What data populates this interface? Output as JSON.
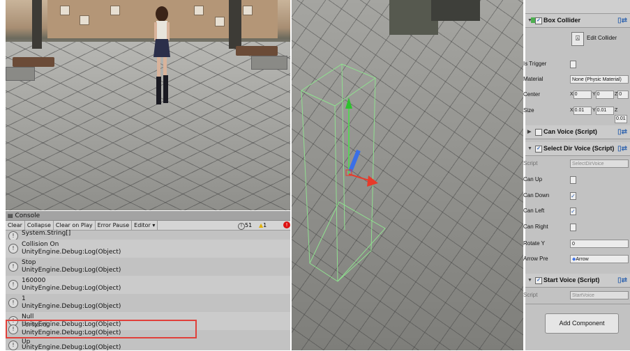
{
  "console": {
    "title": "Console",
    "toolbar": [
      "Clear",
      "Collapse",
      "Clear on Play",
      "Error Pause",
      "Editor"
    ],
    "counts": {
      "info": "51",
      "warn": "1"
    },
    "entries": [
      {
        "line1": "System.String[]",
        "line2": ""
      },
      {
        "line1": "Collision On",
        "line2": "UnityEngine.Debug:Log(Object)"
      },
      {
        "line1": "Stop",
        "line2": "UnityEngine.Debug:Log(Object)"
      },
      {
        "line1": "160000",
        "line2": "UnityEngine.Debug:Log(Object)"
      },
      {
        "line1": "1",
        "line2": "UnityEngine.Debug:Log(Object)"
      },
      {
        "line1": "Null",
        "line2": "UnityEngine.Debug:Log(Object)"
      },
      {
        "line1": "Forward.",
        "line2": "UnityEngine.Debug:Log(Object)"
      },
      {
        "line1": "Up",
        "line2": "UnityEngine.Debug:Log(Object)"
      }
    ],
    "highlight_color": "#e0403a"
  },
  "inspector": {
    "box_collider": {
      "title": "Box Collider",
      "edit_label": "Edit Collider",
      "is_trigger_label": "Is Trigger",
      "material_label": "Material",
      "material_value": "None (Physic Material)",
      "center_label": "Center",
      "center": {
        "x": "0",
        "y": "0",
        "z": "0"
      },
      "size_label": "Size",
      "size": {
        "x": "0.01",
        "y": "0.01",
        "z": "0.01"
      }
    },
    "can_voice": {
      "title": "Can Voice (Script)"
    },
    "select_dir": {
      "title": "Select Dir Voice (Script)",
      "script_label": "Script",
      "script_value": "SelectDirVoice",
      "can_up": "Can Up",
      "can_down": "Can Down",
      "can_left": "Can Left",
      "can_right": "Can Right",
      "rotate_y_label": "Rotate Y",
      "rotate_y_value": "0",
      "arrow_pre_label": "Arrow Pre",
      "arrow_pre_value": "Arrow"
    },
    "start_voice": {
      "title": "Start Voice (Script)",
      "script_label": "Script",
      "script_value": "StartVoice"
    },
    "add_component": "Add Component"
  },
  "colors": {
    "accent": "#2b5fb3",
    "collider_green": "#8fe08f"
  }
}
